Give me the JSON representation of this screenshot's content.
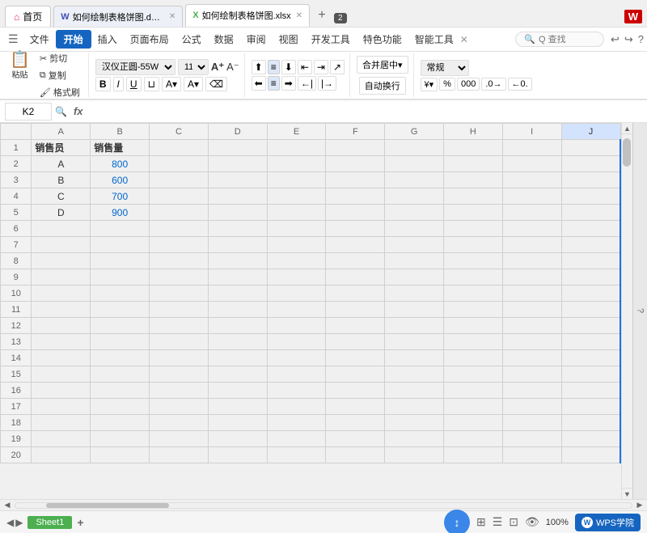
{
  "titleBar": {
    "tabs": [
      {
        "id": "home",
        "label": "首页",
        "type": "home",
        "icon": "🏠"
      },
      {
        "id": "doc",
        "label": "如何绘制表格饼图.docx",
        "type": "doc",
        "closeable": true
      },
      {
        "id": "xlsx",
        "label": "如何绘制表格饼图.xlsx",
        "type": "xlsx",
        "closeable": true,
        "active": true
      }
    ],
    "tabNum": "2",
    "addTabLabel": "+",
    "wpsLogo": "W"
  },
  "menuBar": {
    "items": [
      "文件",
      "开始",
      "插入",
      "页面布局",
      "公式",
      "数据",
      "审阅",
      "视图",
      "开发工具",
      "特色功能",
      "智能工具"
    ],
    "activeItem": "开始",
    "searchPlaceholder": "Q 查找",
    "navIcons": [
      "←",
      "→",
      "↩",
      "↪",
      "?"
    ]
  },
  "ribbon": {
    "groups": [
      {
        "id": "clipboard",
        "buttons": [
          {
            "id": "paste",
            "label": "粘贴",
            "icon": "📋"
          },
          {
            "id": "cut",
            "label": "剪切",
            "icon": "✂"
          },
          {
            "id": "copy",
            "label": "复制",
            "icon": "⧉"
          },
          {
            "id": "format",
            "label": "格式刷",
            "icon": "🖌"
          }
        ]
      },
      {
        "id": "font",
        "fontName": "汉仪正圆-55W",
        "fontSize": "11",
        "buttons": [
          "B",
          "I",
          "U",
          "⊔",
          "A▼",
          "A▼",
          "⌫"
        ]
      },
      {
        "id": "alignment",
        "buttons": [
          "≡",
          "≡",
          "≡",
          "≡",
          "≡",
          "≡",
          "≡",
          "≡",
          "≡",
          "≡",
          "≡",
          "≡"
        ]
      },
      {
        "id": "merge",
        "mergeLabel": "合并居中▼",
        "wrapLabel": "自动换行"
      },
      {
        "id": "format-cells",
        "formatLabel": "常规",
        "buttons": [
          "⊕",
          "%",
          "000",
          ".0→",
          ".0←"
        ]
      }
    ]
  },
  "formulaBar": {
    "cellRef": "K2",
    "functionIcon": "fx",
    "value": ""
  },
  "spreadsheet": {
    "columns": [
      "",
      "A",
      "B",
      "C",
      "D",
      "E",
      "F",
      "G",
      "H",
      "I",
      "J"
    ],
    "rows": [
      {
        "num": "1",
        "cells": [
          "销售员",
          "销售量",
          "",
          "",
          "",
          "",
          "",
          "",
          "",
          "",
          ""
        ]
      },
      {
        "num": "2",
        "cells": [
          "A",
          "800",
          "",
          "",
          "",
          "",
          "",
          "",
          "",
          "",
          ""
        ]
      },
      {
        "num": "3",
        "cells": [
          "B",
          "600",
          "",
          "",
          "",
          "",
          "",
          "",
          "",
          "",
          ""
        ]
      },
      {
        "num": "4",
        "cells": [
          "C",
          "700",
          "",
          "",
          "",
          "",
          "",
          "",
          "",
          "",
          ""
        ]
      },
      {
        "num": "5",
        "cells": [
          "D",
          "900",
          "",
          "",
          "",
          "",
          "",
          "",
          "",
          "",
          ""
        ]
      },
      {
        "num": "6",
        "cells": [
          "",
          "",
          "",
          "",
          "",
          "",
          "",
          "",
          "",
          "",
          ""
        ]
      },
      {
        "num": "7",
        "cells": [
          "",
          "",
          "",
          "",
          "",
          "",
          "",
          "",
          "",
          "",
          ""
        ]
      },
      {
        "num": "8",
        "cells": [
          "",
          "",
          "",
          "",
          "",
          "",
          "",
          "",
          "",
          "",
          ""
        ]
      },
      {
        "num": "9",
        "cells": [
          "",
          "",
          "",
          "",
          "",
          "",
          "",
          "",
          "",
          "",
          ""
        ]
      },
      {
        "num": "10",
        "cells": [
          "",
          "",
          "",
          "",
          "",
          "",
          "",
          "",
          "",
          "",
          ""
        ]
      },
      {
        "num": "11",
        "cells": [
          "",
          "",
          "",
          "",
          "",
          "",
          "",
          "",
          "",
          "",
          ""
        ]
      },
      {
        "num": "12",
        "cells": [
          "",
          "",
          "",
          "",
          "",
          "",
          "",
          "",
          "",
          "",
          ""
        ]
      },
      {
        "num": "13",
        "cells": [
          "",
          "",
          "",
          "",
          "",
          "",
          "",
          "",
          "",
          "",
          ""
        ]
      },
      {
        "num": "14",
        "cells": [
          "",
          "",
          "",
          "",
          "",
          "",
          "",
          "",
          "",
          "",
          ""
        ]
      },
      {
        "num": "15",
        "cells": [
          "",
          "",
          "",
          "",
          "",
          "",
          "",
          "",
          "",
          "",
          ""
        ]
      },
      {
        "num": "16",
        "cells": [
          "",
          "",
          "",
          "",
          "",
          "",
          "",
          "",
          "",
          "",
          ""
        ]
      },
      {
        "num": "17",
        "cells": [
          "",
          "",
          "",
          "",
          "",
          "",
          "",
          "",
          "",
          "",
          ""
        ]
      },
      {
        "num": "18",
        "cells": [
          "",
          "",
          "",
          "",
          "",
          "",
          "",
          "",
          "",
          "",
          ""
        ]
      },
      {
        "num": "19",
        "cells": [
          "",
          "",
          "",
          "",
          "",
          "",
          "",
          "",
          "",
          "",
          ""
        ]
      },
      {
        "num": "20",
        "cells": [
          "",
          "",
          "",
          "",
          "",
          "",
          "",
          "",
          "",
          "",
          ""
        ]
      }
    ],
    "selectedCell": "K2",
    "activeCol": "K",
    "activeColIndex": 10
  },
  "statusBar": {
    "sheetName": "Sheet1",
    "addSheetLabel": "+",
    "zoomLevel": "100%",
    "icons": [
      "⊞",
      "☰",
      "⊡",
      "👁"
    ],
    "wpsAcademy": "WPS学院"
  }
}
